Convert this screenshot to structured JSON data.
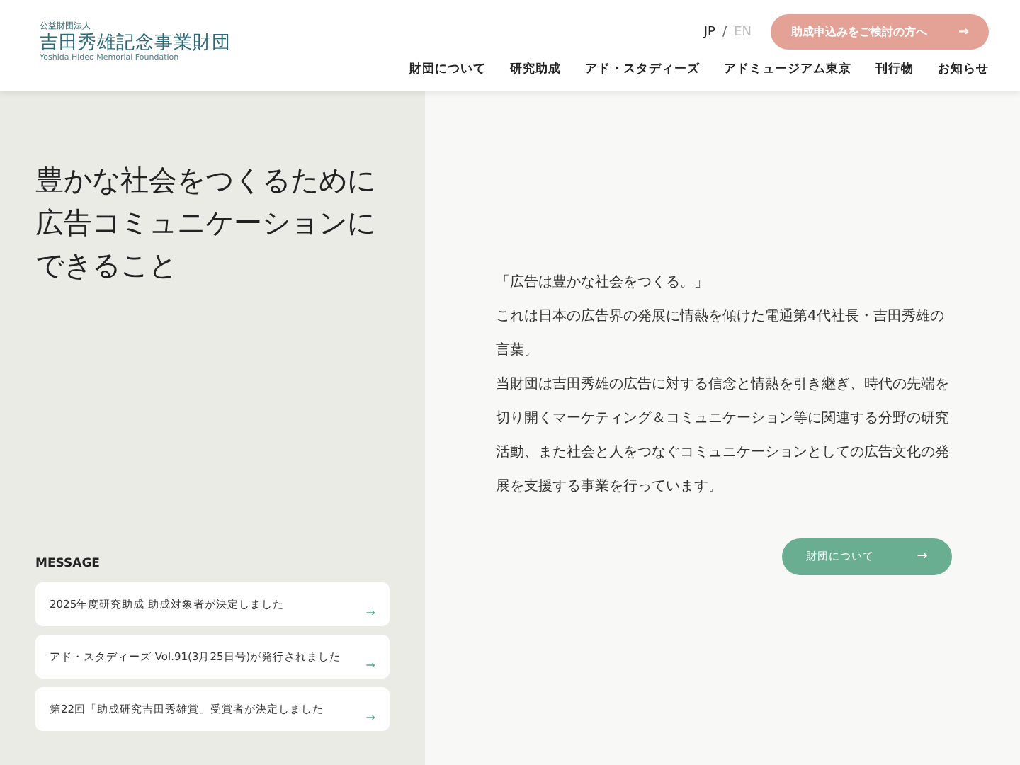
{
  "header": {
    "logo": {
      "tagline": "公益財団法人",
      "name": "吉田秀雄記念事業財団",
      "roman": "Yoshida Hideo Memorial Foundation"
    },
    "languages": [
      {
        "label": "JP",
        "selected": true
      },
      {
        "label": "EN",
        "selected": false
      }
    ],
    "language_separator": "/",
    "cta_button": {
      "label": "助成申込みをご検討の方へ",
      "icon": "→"
    },
    "nav": [
      "財団について",
      "研究助成",
      "アド・スタディーズ",
      "アドミュージアム東京",
      "刊行物",
      "お知らせ"
    ]
  },
  "hero": {
    "headline_lines": [
      "豊かな社会をつくるために",
      "広告コミュニケーションに",
      "できること"
    ]
  },
  "message": {
    "heading": "MESSAGE",
    "items": [
      {
        "text": "2025年度研究助成 助成対象者が決定しました",
        "icon": "→"
      },
      {
        "text": "アド・スタディーズ Vol.91(3月25日号)が発行されました",
        "icon": "→"
      },
      {
        "text": "第22回「助成研究吉田秀雄賞」受賞者が決定しました",
        "icon": "→"
      }
    ]
  },
  "intro": {
    "paragraphs": [
      "「広告は豊かな社会をつくる。」",
      "これは日本の広告界の発展に情熱を傾けた電通第4代社長・吉田秀雄の言葉。",
      "当財団は吉田秀雄の広告に対する信念と情熱を引き継ぎ、時代の先端を切り開くマーケティング＆コミュニケーション等に関連する分野の研究活動、また社会と人をつなぐコミュニケーションとしての広告文化の発展を支援する事業を行っています。"
    ],
    "button": {
      "label": "財団について",
      "icon": "→"
    }
  }
}
